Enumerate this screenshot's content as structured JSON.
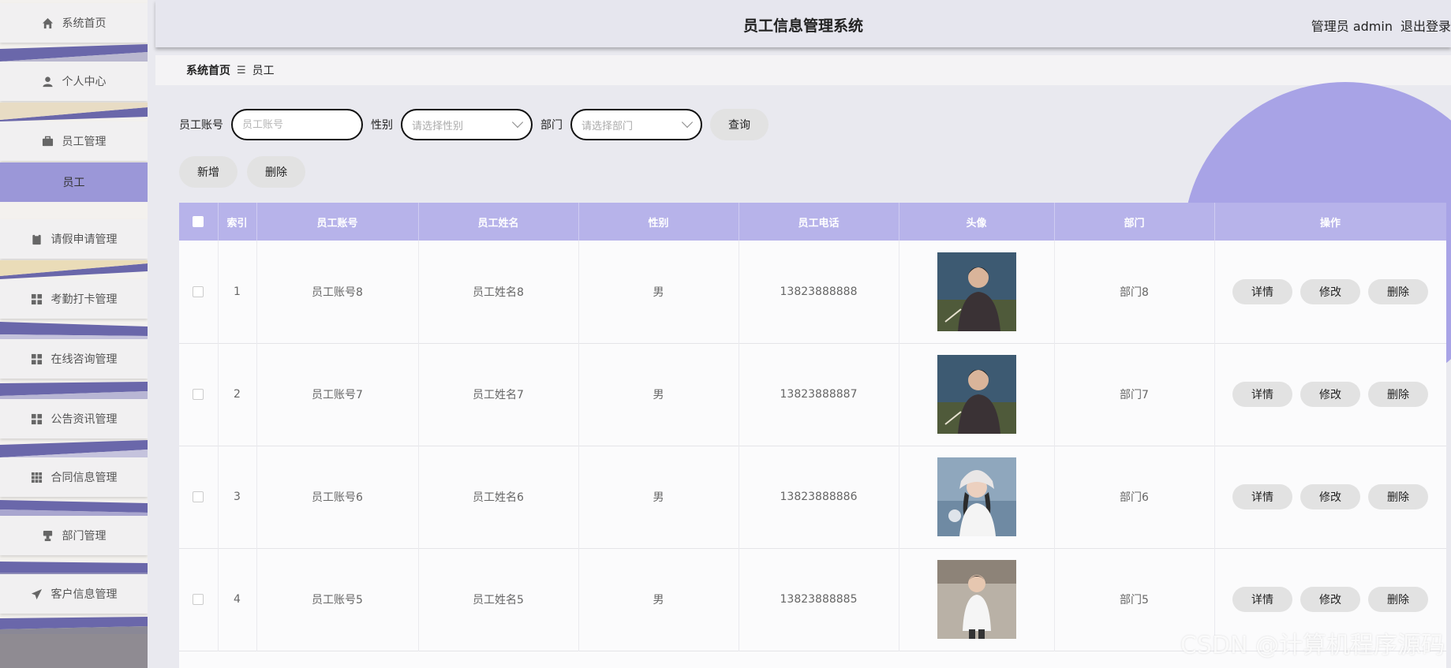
{
  "app": {
    "title": "员工信息管理系统"
  },
  "user": {
    "role_name": "管理员 admin",
    "logout_label": "退出登录"
  },
  "sidebar": {
    "items": [
      {
        "label": "系统首页",
        "icon": "home-icon"
      },
      {
        "label": "个人中心",
        "icon": "user-icon"
      },
      {
        "label": "员工管理",
        "icon": "briefcase-icon"
      },
      {
        "label": "请假申请管理",
        "icon": "clipboard-icon"
      },
      {
        "label": "考勤打卡管理",
        "icon": "grid-icon"
      },
      {
        "label": "在线咨询管理",
        "icon": "grid-icon"
      },
      {
        "label": "公告资讯管理",
        "icon": "grid-icon"
      },
      {
        "label": "合同信息管理",
        "icon": "apps-icon"
      },
      {
        "label": "部门管理",
        "icon": "stamp-icon"
      },
      {
        "label": "客户信息管理",
        "icon": "send-icon"
      }
    ],
    "active_sub": "员工",
    "colors": {
      "active": "#9b97d8",
      "stripe": "#6a67aa"
    }
  },
  "breadcrumb": {
    "home": "系统首页",
    "current": "员工"
  },
  "search": {
    "account_label": "员工账号",
    "account_placeholder": "员工账号",
    "gender_label": "性别",
    "gender_placeholder": "请选择性别",
    "dept_label": "部门",
    "dept_placeholder": "请选择部门",
    "query_label": "查询"
  },
  "actions": {
    "add_label": "新增",
    "delete_label": "删除"
  },
  "table": {
    "headers": [
      "索引",
      "员工账号",
      "员工姓名",
      "性别",
      "员工电话",
      "头像",
      "部门",
      "操作"
    ],
    "rows": [
      {
        "index": "1",
        "account": "员工账号8",
        "name": "员工姓名8",
        "gender": "男",
        "phone": "13823888888",
        "dept": "部门8",
        "avatar": "avatar-man"
      },
      {
        "index": "2",
        "account": "员工账号7",
        "name": "员工姓名7",
        "gender": "男",
        "phone": "13823888887",
        "dept": "部门7",
        "avatar": "avatar-man"
      },
      {
        "index": "3",
        "account": "员工账号6",
        "name": "员工姓名6",
        "gender": "男",
        "phone": "13823888886",
        "dept": "部门6",
        "avatar": "avatar-girl"
      },
      {
        "index": "4",
        "account": "员工账号5",
        "name": "员工姓名5",
        "gender": "男",
        "phone": "13823888885",
        "dept": "部门5",
        "avatar": "avatar-boy"
      }
    ],
    "row_actions": {
      "detail": "详情",
      "edit": "修改",
      "delete": "删除"
    },
    "header_color": "#b7b3ea"
  },
  "watermark": "CSDN @计算机程序源码"
}
